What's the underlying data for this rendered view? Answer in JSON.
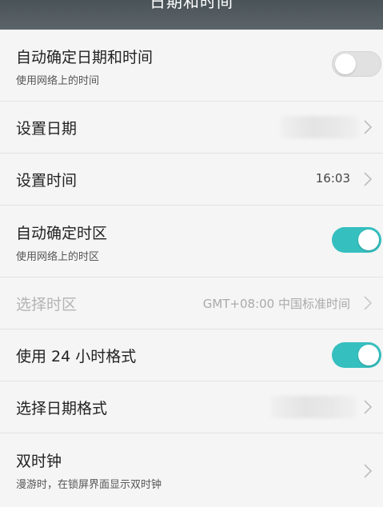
{
  "header": {
    "title": "日期和时间"
  },
  "colors": {
    "accent": "#36bfbf",
    "header_bg": "#4a5358",
    "background": "#f5f5f5"
  },
  "settings": {
    "auto_datetime": {
      "label": "自动确定日期和时间",
      "sub": "使用网络上的时间",
      "toggle": "off"
    },
    "set_date": {
      "label": "设置日期",
      "value": ""
    },
    "set_time": {
      "label": "设置时间",
      "value": "16:03"
    },
    "auto_timezone": {
      "label": "自动确定时区",
      "sub": "使用网络上的时区",
      "toggle": "on"
    },
    "select_timezone": {
      "label": "选择时区",
      "value": "GMT+08:00 中国标准时间",
      "enabled": false
    },
    "use_24h": {
      "label": "使用 24 小时格式",
      "toggle": "on"
    },
    "date_format": {
      "label": "选择日期格式",
      "value": ""
    },
    "dual_clock": {
      "label": "双时钟",
      "sub": "漫游时，在锁屏界面显示双时钟"
    }
  },
  "icons": {
    "row_arrow": "chevron-right-icon"
  }
}
